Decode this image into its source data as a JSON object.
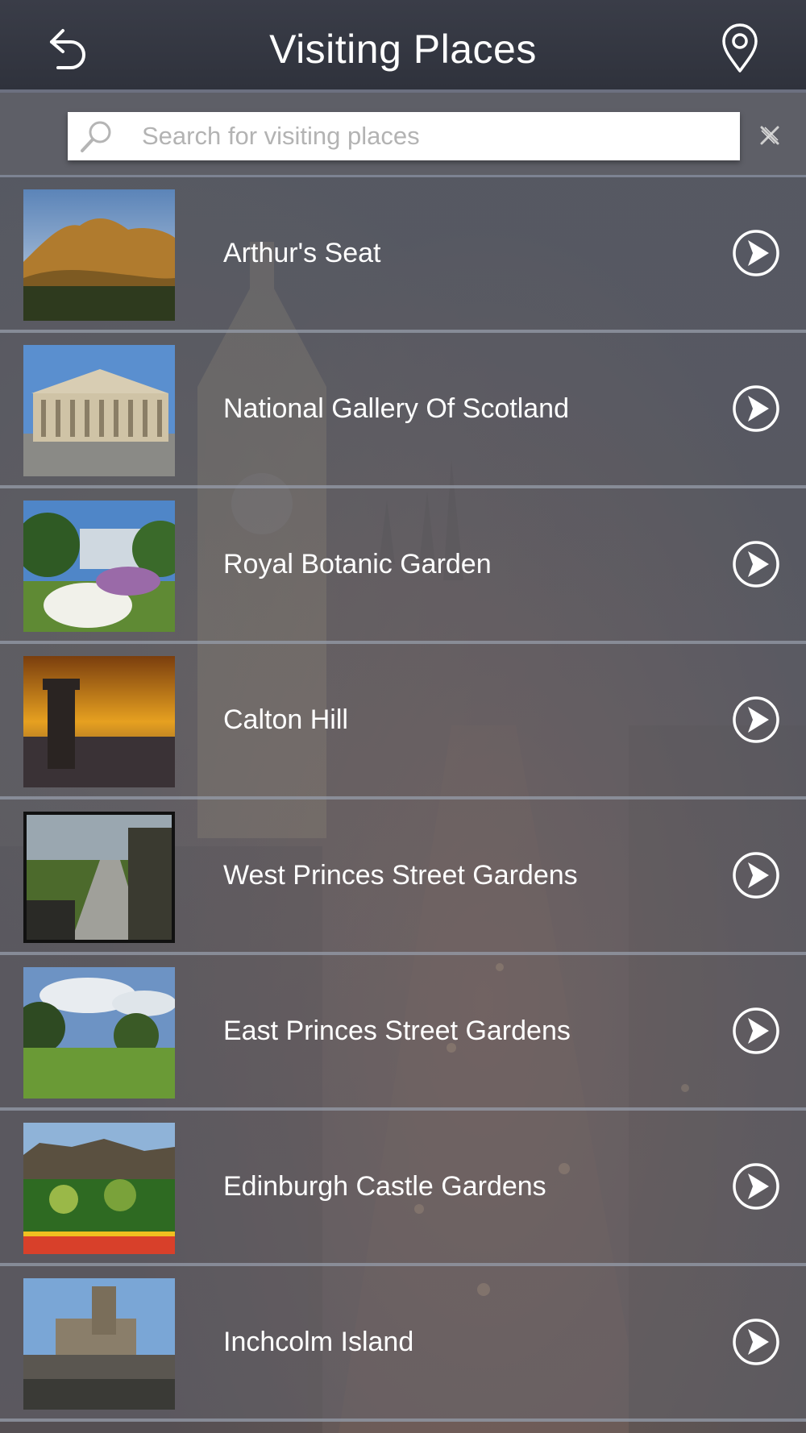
{
  "header": {
    "title": "Visiting Places",
    "back_icon": "back-arrow-icon",
    "location_icon": "map-pin-icon"
  },
  "search": {
    "placeholder": "Search for visiting places",
    "value": "",
    "search_icon": "magnifier-icon",
    "clear_icon": "clear-x-icon"
  },
  "places": [
    {
      "name": "Arthur's Seat"
    },
    {
      "name": "National Gallery Of Scotland"
    },
    {
      "name": "Royal Botanic Garden"
    },
    {
      "name": "Calton Hill"
    },
    {
      "name": "West Princes Street Gardens"
    },
    {
      "name": "East Princes Street Gardens"
    },
    {
      "name": "Edinburgh Castle Gardens"
    },
    {
      "name": "Inchcolm Island"
    }
  ],
  "colors": {
    "header_bg": "#2f323c",
    "row_text": "#ffffff",
    "divider": "#969caa"
  }
}
